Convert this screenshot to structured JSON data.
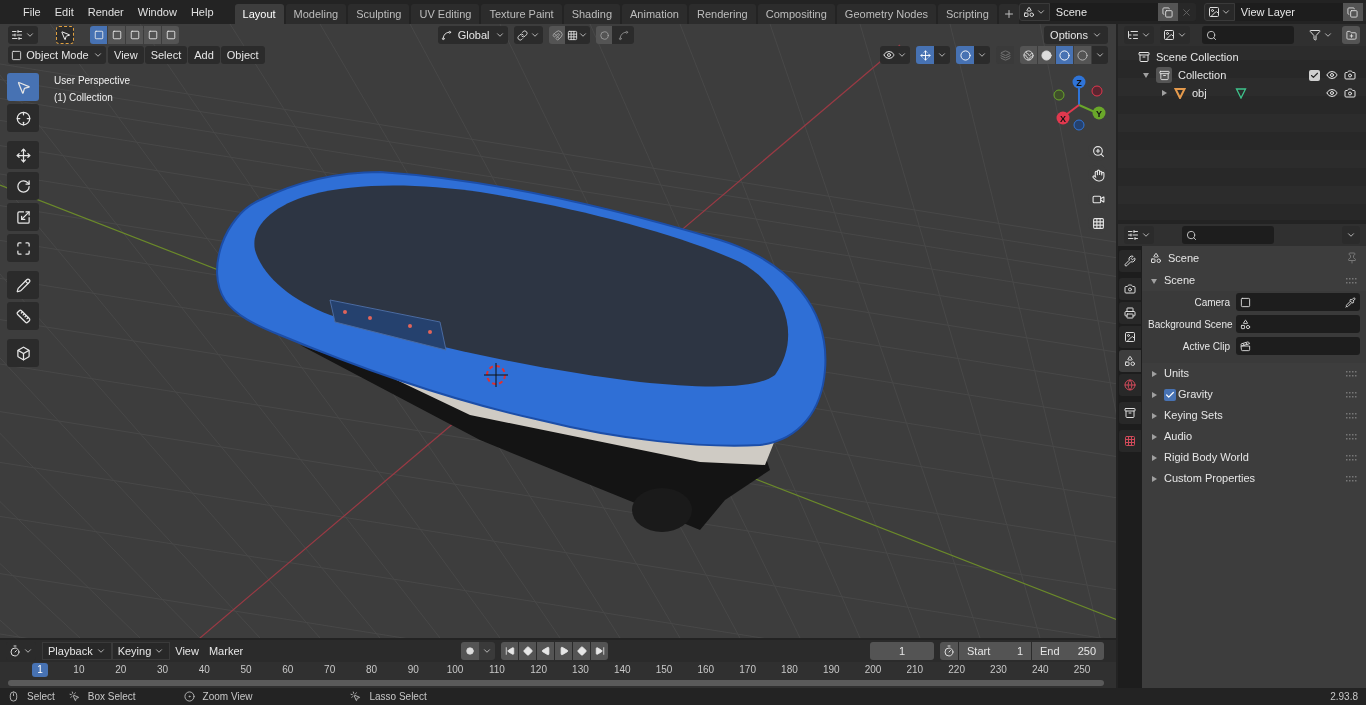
{
  "menu": [
    "File",
    "Edit",
    "Render",
    "Window",
    "Help"
  ],
  "workspaces": [
    {
      "label": "Layout",
      "selected": true
    },
    {
      "label": "Modeling",
      "selected": false
    },
    {
      "label": "Sculpting",
      "selected": false
    },
    {
      "label": "UV Editing",
      "selected": false
    },
    {
      "label": "Texture Paint",
      "selected": false
    },
    {
      "label": "Shading",
      "selected": false
    },
    {
      "label": "Animation",
      "selected": false
    },
    {
      "label": "Rendering",
      "selected": false
    },
    {
      "label": "Compositing",
      "selected": false
    },
    {
      "label": "Geometry Nodes",
      "selected": false
    },
    {
      "label": "Scripting",
      "selected": false
    }
  ],
  "scene_field": {
    "value": "Scene"
  },
  "view_layer_field": {
    "value": "View Layer"
  },
  "viewport": {
    "select_modes": [
      {
        "selected": true
      },
      {
        "selected": false
      },
      {
        "selected": false
      },
      {
        "selected": false
      },
      {
        "selected": false
      }
    ],
    "transform_orientation": "Global",
    "options": "Options",
    "mode": "Object Mode",
    "header_menus": [
      "View",
      "Select",
      "Add",
      "Object"
    ],
    "toggles": [
      {
        "kind": "gizmo",
        "on": true
      },
      {
        "kind": "overlay",
        "on": true
      },
      {
        "kind": "xray",
        "on": false
      }
    ],
    "shading_modes": [
      {
        "kind": "wireframe",
        "selected": false
      },
      {
        "kind": "solid",
        "selected": false
      },
      {
        "kind": "material",
        "selected": true
      },
      {
        "kind": "rendered",
        "selected": false
      }
    ],
    "overlay_text": [
      "User Perspective",
      "(1) Collection"
    ],
    "tools": [
      {
        "kind": "select",
        "selected": true
      },
      {
        "kind": "cursor",
        "selected": false
      },
      {
        "kind": "move",
        "selected": false
      },
      {
        "kind": "rotate",
        "selected": false
      },
      {
        "kind": "scale",
        "selected": false
      },
      {
        "kind": "transform",
        "selected": false
      },
      {
        "kind": "annotate",
        "selected": false
      },
      {
        "kind": "measure",
        "selected": false
      },
      {
        "kind": "add-cube",
        "selected": false
      }
    ],
    "gizmo_axes": [
      {
        "label": "Z",
        "color": "#2f74d8"
      },
      {
        "label": "Y",
        "color": "#6aa72a"
      },
      {
        "label": "X",
        "color": "#e0384e"
      }
    ]
  },
  "outliner": {
    "items": [
      {
        "label": "Scene Collection",
        "kind": "scene-collection",
        "children": [
          {
            "label": "Collection",
            "kind": "collection",
            "expanded": true,
            "checked": true,
            "children": [
              {
                "label": "obj",
                "kind": "object",
                "expanded": false
              }
            ]
          }
        ]
      }
    ]
  },
  "properties": {
    "tabs": [
      {
        "kind": "tool",
        "selected": false
      },
      {
        "kind": "render",
        "selected": false
      },
      {
        "kind": "output",
        "selected": false
      },
      {
        "kind": "view-layer",
        "selected": false
      },
      {
        "kind": "scene",
        "selected": true
      },
      {
        "kind": "world",
        "selected": false
      },
      {
        "kind": "collection",
        "selected": false
      },
      {
        "kind": "texture",
        "selected": false
      }
    ],
    "breadcrumb": "Scene",
    "panels": [
      {
        "label": "Scene",
        "expanded": true,
        "fields": [
          {
            "label": "Camera",
            "kind": "camera"
          },
          {
            "label": "Background Scene",
            "kind": "scene"
          },
          {
            "label": "Active Clip",
            "kind": "clip"
          }
        ]
      },
      {
        "label": "Units",
        "expanded": false
      },
      {
        "label": "Gravity",
        "expanded": false,
        "checked": true
      },
      {
        "label": "Keying Sets",
        "expanded": false
      },
      {
        "label": "Audio",
        "expanded": false
      },
      {
        "label": "Rigid Body World",
        "expanded": false
      },
      {
        "label": "Custom Properties",
        "expanded": false
      }
    ]
  },
  "timeline": {
    "menus": [
      {
        "label": "Playback",
        "dropdown": true
      },
      {
        "label": "Keying",
        "dropdown": true
      },
      {
        "label": "View",
        "dropdown": false
      },
      {
        "label": "Marker",
        "dropdown": false
      }
    ],
    "current_frame": "1",
    "start": {
      "label": "Start",
      "value": "1"
    },
    "end": {
      "label": "End",
      "value": "250"
    },
    "ruler": [
      {
        "label": "1",
        "selected": true
      },
      {
        "label": "10",
        "selected": false
      },
      {
        "label": "20",
        "selected": false
      },
      {
        "label": "30",
        "selected": false
      },
      {
        "label": "40",
        "selected": false
      },
      {
        "label": "50",
        "selected": false
      },
      {
        "label": "60",
        "selected": false
      },
      {
        "label": "70",
        "selected": false
      },
      {
        "label": "80",
        "selected": false
      },
      {
        "label": "90",
        "selected": false
      },
      {
        "label": "100",
        "selected": false
      },
      {
        "label": "110",
        "selected": false
      },
      {
        "label": "120",
        "selected": false
      },
      {
        "label": "130",
        "selected": false
      },
      {
        "label": "140",
        "selected": false
      },
      {
        "label": "150",
        "selected": false
      },
      {
        "label": "160",
        "selected": false
      },
      {
        "label": "170",
        "selected": false
      },
      {
        "label": "180",
        "selected": false
      },
      {
        "label": "190",
        "selected": false
      },
      {
        "label": "200",
        "selected": false
      },
      {
        "label": "210",
        "selected": false
      },
      {
        "label": "220",
        "selected": false
      },
      {
        "label": "230",
        "selected": false
      },
      {
        "label": "240",
        "selected": false
      },
      {
        "label": "250",
        "selected": false
      }
    ]
  },
  "status_bar": {
    "hints": [
      {
        "label": "Select",
        "kind": "click"
      },
      {
        "label": "Box Select",
        "kind": "drag"
      },
      {
        "label": "Zoom View",
        "kind": "middle"
      },
      {
        "label": "Lasso Select",
        "kind": "drag"
      }
    ],
    "version": "2.93.8"
  }
}
